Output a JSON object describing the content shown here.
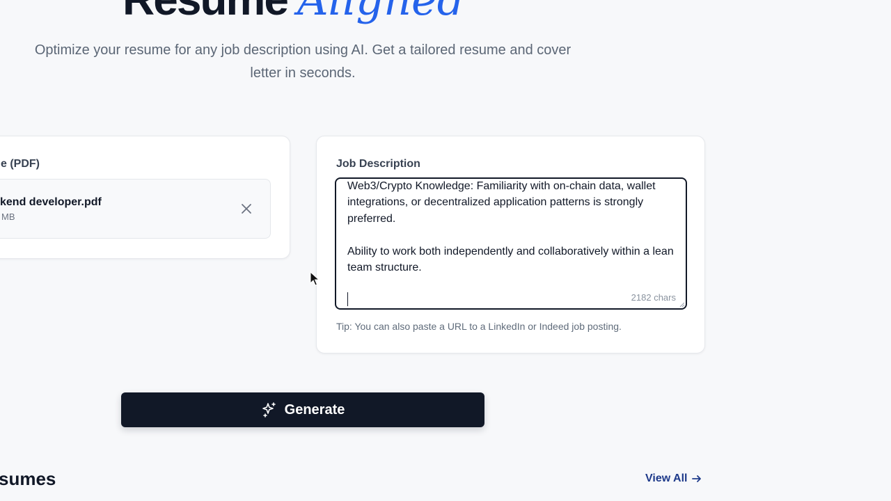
{
  "hero": {
    "title_main": "Resume",
    "title_accent": "Aligned",
    "subtitle": "Optimize your resume for any job description using AI. Get a tailored resume and cover letter in seconds."
  },
  "upload": {
    "label": "e (PDF)",
    "file_name": "kend developer.pdf",
    "file_size": "MB",
    "remove_icon": "close-icon"
  },
  "job_description": {
    "label": "Job Description",
    "text": "Web3/Crypto Knowledge: Familiarity with on-chain data, wallet integrations, or decentralized application patterns is strongly preferred.\n\nAbility to work both independently and collaboratively within a lean team structure.",
    "char_count": "2182 chars",
    "tip": "Tip: You can also paste a URL to a LinkedIn or Indeed job posting."
  },
  "generate": {
    "label": "Generate",
    "icon": "sparkles-icon"
  },
  "recent": {
    "heading": "sumes",
    "view_all": "View All",
    "view_all_icon": "arrow-right-icon"
  },
  "colors": {
    "accent": "#2563eb",
    "primary_dark": "#111827",
    "link": "#1e3a8a",
    "background": "#f7f8fa"
  }
}
